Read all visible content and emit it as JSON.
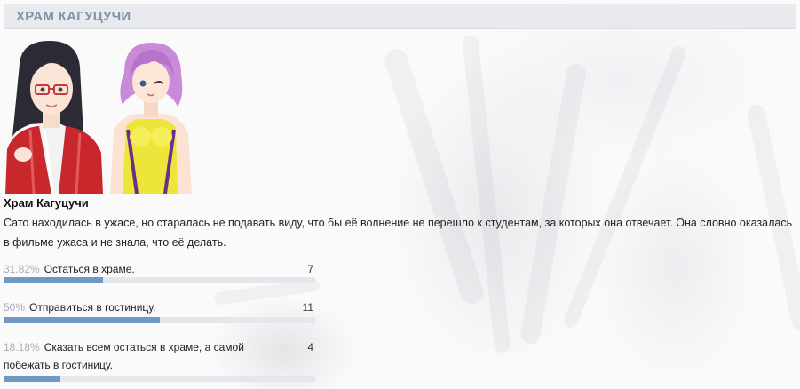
{
  "header": {
    "title": "ХРАМ КАГУЦУЧИ"
  },
  "story": {
    "title": "Храм Кагуцучи",
    "text": "Сато находилась в ужасе, но старалась не подавать виду, что бы её волнение не перешло к студентам, за которых она отвечает. Она словно оказалась в фильме ужаса и не знала, что её делать."
  },
  "poll": {
    "options": [
      {
        "percent": "31.82%",
        "label": "Остаться в храме.",
        "votes": "7",
        "fraction": 0.3182
      },
      {
        "percent": "50%",
        "label": "Отправиться в гостиницу.",
        "votes": "11",
        "fraction": 0.5
      },
      {
        "percent": "18.18%",
        "label": "Сказать всем остаться в храме, а самой побежать в гостиницу.",
        "votes": "4",
        "fraction": 0.1818
      }
    ]
  },
  "colors": {
    "header_bg": "#e8eaee",
    "header_text": "#7f93ad",
    "bar_fill": "#6f99c4",
    "bar_track": "#e4e7ec"
  },
  "icons": {
    "portrait_1": "character-portrait-glasses-red-jacket",
    "portrait_2": "character-portrait-pink-hair-yellow-swimsuit"
  }
}
